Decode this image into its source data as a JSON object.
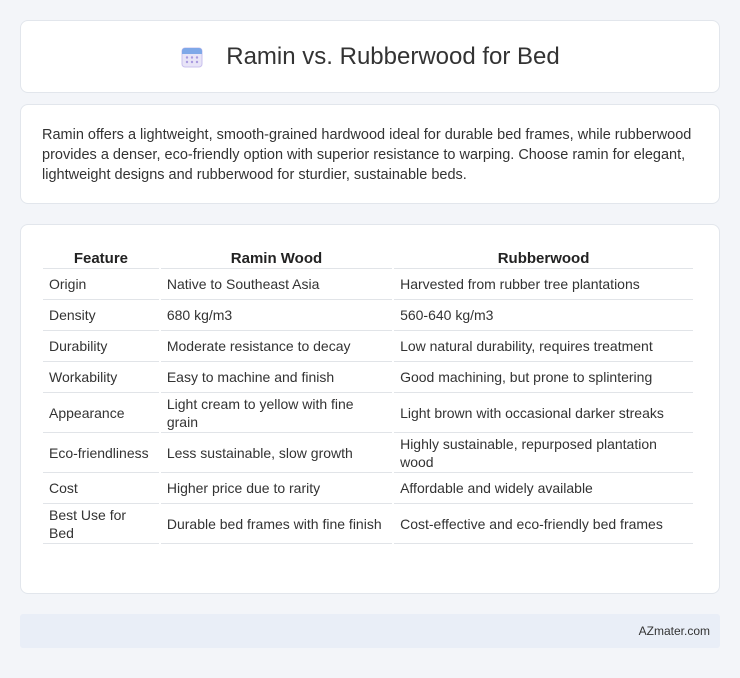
{
  "header": {
    "title": "Ramin vs. Rubberwood for Bed",
    "icon": "calendar-icon"
  },
  "summary": {
    "text": "Ramin offers a lightweight, smooth-grained hardwood ideal for durable bed frames, while rubberwood provides a denser, eco-friendly option with superior resistance to warping. Choose ramin for elegant, lightweight designs and rubberwood for sturdier, sustainable beds."
  },
  "table": {
    "headers": [
      "Feature",
      "Ramin Wood",
      "Rubberwood"
    ],
    "rows": [
      [
        "Origin",
        "Native to Southeast Asia",
        "Harvested from rubber tree plantations"
      ],
      [
        "Density",
        "680 kg/m3",
        "560-640 kg/m3"
      ],
      [
        "Durability",
        "Moderate resistance to decay",
        "Low natural durability, requires treatment"
      ],
      [
        "Workability",
        "Easy to machine and finish",
        "Good machining, but prone to splintering"
      ],
      [
        "Appearance",
        "Light cream to yellow with fine grain",
        "Light brown with occasional darker streaks"
      ],
      [
        "Eco-friendliness",
        "Less sustainable, slow growth",
        "Highly sustainable, repurposed plantation wood"
      ],
      [
        "Cost",
        "Higher price due to rarity",
        "Affordable and widely available"
      ],
      [
        "Best Use for Bed",
        "Durable bed frames with fine finish",
        "Cost-effective and eco-friendly bed frames"
      ]
    ]
  },
  "footer": {
    "brand": "AZmater.com"
  }
}
